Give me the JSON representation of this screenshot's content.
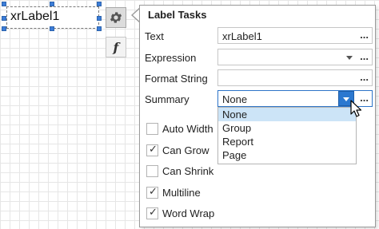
{
  "design_surface": {
    "label_text": "xrLabel1",
    "smart_tag_icon": "gear-icon",
    "expression_icon": "f"
  },
  "panel": {
    "title": "Label Tasks",
    "rows": {
      "text": {
        "label": "Text",
        "value": "xrLabel1",
        "ellipsis": "..."
      },
      "expression": {
        "label": "Expression",
        "value": "",
        "ellipsis": "..."
      },
      "format_string": {
        "label": "Format String",
        "value": "",
        "ellipsis": "..."
      },
      "summary": {
        "label": "Summary",
        "value": "None",
        "ellipsis": "..."
      }
    },
    "summary_options": [
      "None",
      "Group",
      "Report",
      "Page"
    ],
    "summary_selected_index": 0,
    "checkboxes": [
      {
        "label": "Auto Width",
        "checked": false
      },
      {
        "label": "Can Grow",
        "checked": true
      },
      {
        "label": "Can Shrink",
        "checked": false
      },
      {
        "label": "Multiline",
        "checked": true
      },
      {
        "label": "Word Wrap",
        "checked": true
      }
    ]
  },
  "colors": {
    "accent": "#2b78d0",
    "selection": "#cce4f7",
    "handle": "#3b7dd8"
  }
}
